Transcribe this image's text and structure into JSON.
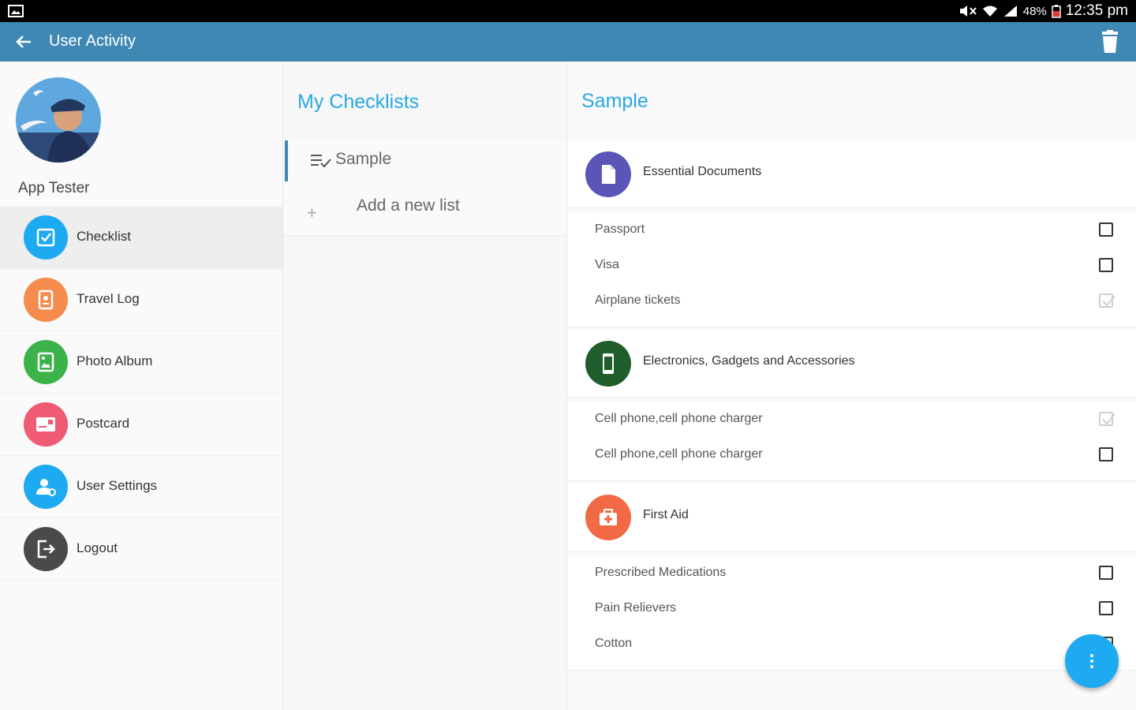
{
  "status_bar": {
    "battery_percent": "48%",
    "time": "12:35 pm"
  },
  "app_bar": {
    "title": "User Activity"
  },
  "profile": {
    "name": "App Tester"
  },
  "nav": {
    "items": [
      {
        "label": "Checklist",
        "color": "#1eaaf1",
        "icon": "checkbox-icon"
      },
      {
        "label": "Travel Log",
        "color": "#f58b4c",
        "icon": "passport-icon"
      },
      {
        "label": "Photo Album",
        "color": "#3cb34a",
        "icon": "photo-icon"
      },
      {
        "label": "Postcard",
        "color": "#ef5b72",
        "icon": "postcard-icon"
      },
      {
        "label": "User Settings",
        "color": "#1eaaf1",
        "icon": "user-settings-icon"
      },
      {
        "label": "Logout",
        "color": "#4a4a4a",
        "icon": "logout-icon"
      }
    ]
  },
  "checklists": {
    "heading": "My Checklists",
    "selected": "Sample",
    "add_label": "Add a new list",
    "add_symbol": "+"
  },
  "detail": {
    "heading": "Sample",
    "categories": [
      {
        "label": "Essential Documents",
        "color": "#5c55b8",
        "icon": "document-icon",
        "items": [
          {
            "label": "Passport",
            "checked": false
          },
          {
            "label": "Visa",
            "checked": false
          },
          {
            "label": "Airplane tickets",
            "checked": true
          }
        ]
      },
      {
        "label": "Electronics, Gadgets and Accessories",
        "color": "#1f5e2b",
        "icon": "phone-icon",
        "items": [
          {
            "label": "Cell phone,cell phone charger",
            "checked": true
          },
          {
            "label": "Cell phone,cell phone charger",
            "checked": false
          }
        ]
      },
      {
        "label": "First Aid",
        "color": "#f26a45",
        "icon": "first-aid-icon",
        "items": [
          {
            "label": "Prescribed Medications",
            "checked": false
          },
          {
            "label": "Pain Relievers",
            "checked": false
          },
          {
            "label": "Cotton",
            "checked": false
          }
        ]
      }
    ]
  },
  "fab": {
    "icon": "more-vert-icon",
    "color": "#1eaaf1"
  }
}
